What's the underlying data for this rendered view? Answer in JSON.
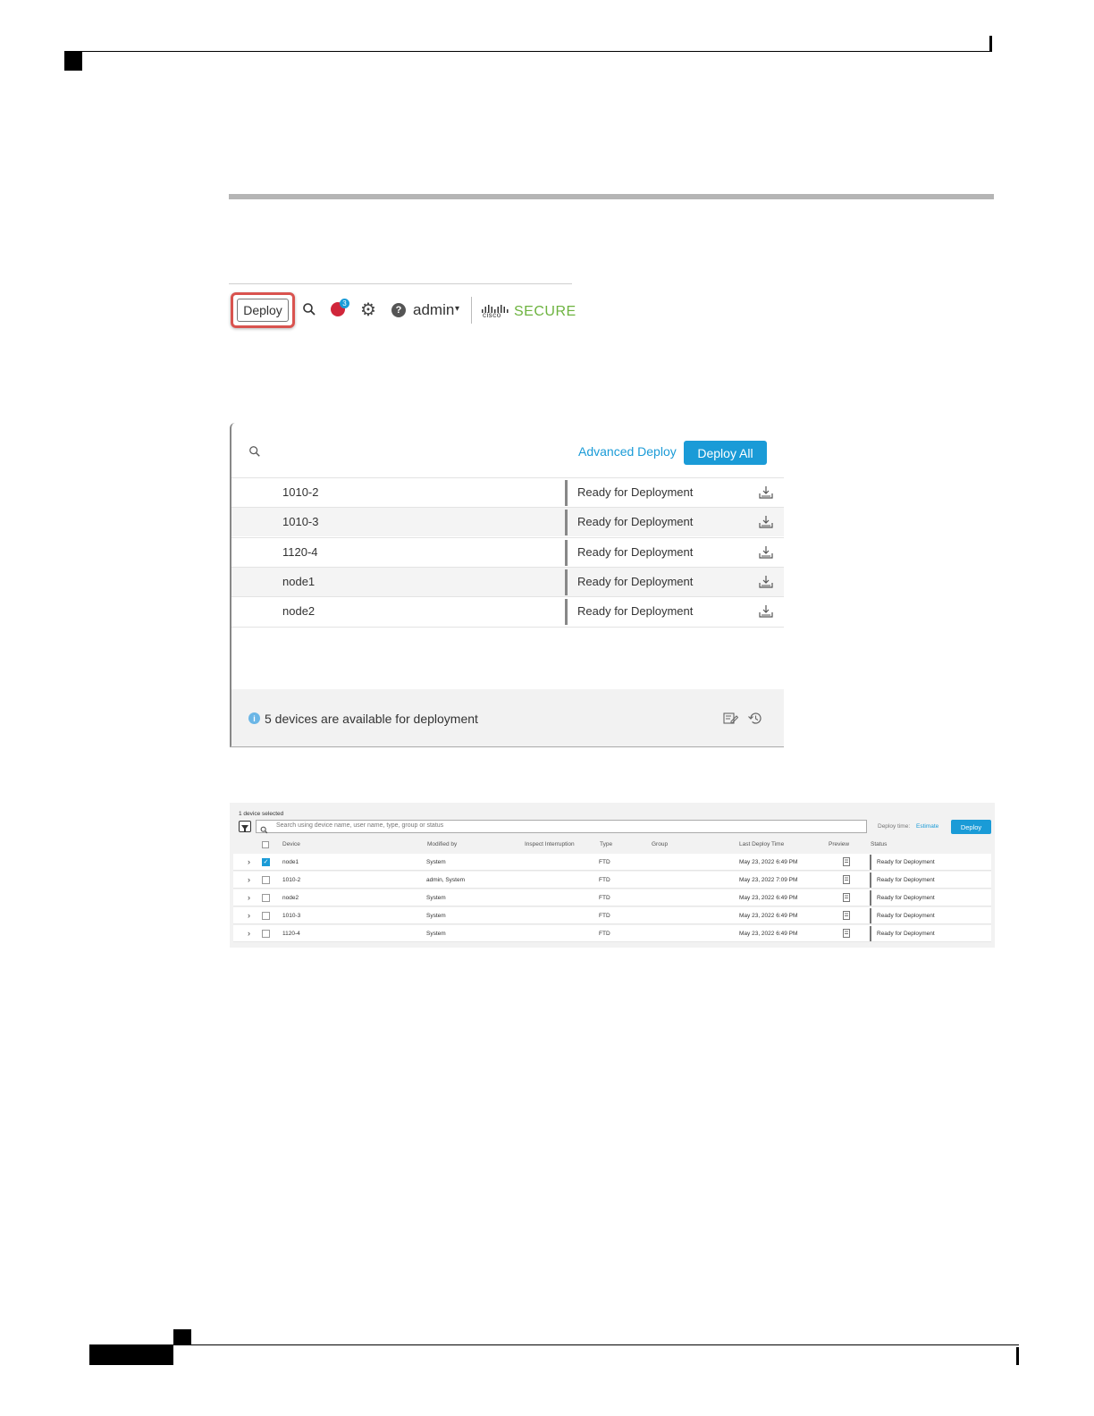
{
  "toolbar": {
    "deploy_label": "Deploy",
    "alert_count": "3",
    "help_glyph": "?",
    "user_label": "admin",
    "caret": "▾",
    "brand_small": "cisco",
    "brand_label": "SECURE"
  },
  "panel": {
    "advanced_label": "Advanced Deploy",
    "deploy_all_label": "Deploy All",
    "rows": [
      {
        "name": "1010-2",
        "status": "Ready for Deployment"
      },
      {
        "name": "1010-3",
        "status": "Ready for Deployment"
      },
      {
        "name": "1120-4",
        "status": "Ready for Deployment"
      },
      {
        "name": "node1",
        "status": "Ready for Deployment"
      },
      {
        "name": "node2",
        "status": "Ready for Deployment"
      }
    ],
    "footer_text": "5 devices are available for deployment",
    "info_glyph": "i"
  },
  "advanced": {
    "selected_text": "1 device selected",
    "search_placeholder": "Search using device name, user name, type, group or status",
    "deploy_time_label": "Deploy time:",
    "estimate_label": "Estimate",
    "deploy_label": "Deploy",
    "headers": {
      "device": "Device",
      "modified_by": "Modified by",
      "inspect": "Inspect Interruption",
      "type": "Type",
      "group": "Group",
      "last_deploy": "Last Deploy Time",
      "preview": "Preview",
      "status": "Status"
    },
    "rows": [
      {
        "device": "node1",
        "modified_by": "System",
        "type": "FTD",
        "last_deploy": "May 23, 2022 6:49 PM",
        "status": "Ready for Deployment",
        "checked": true
      },
      {
        "device": "1010-2",
        "modified_by": "admin, System",
        "type": "FTD",
        "last_deploy": "May 23, 2022 7:09 PM",
        "status": "Ready for Deployment",
        "checked": false
      },
      {
        "device": "node2",
        "modified_by": "System",
        "type": "FTD",
        "last_deploy": "May 23, 2022 6:49 PM",
        "status": "Ready for Deployment",
        "checked": false
      },
      {
        "device": "1010-3",
        "modified_by": "System",
        "type": "FTD",
        "last_deploy": "May 23, 2022 6:49 PM",
        "status": "Ready for Deployment",
        "checked": false
      },
      {
        "device": "1120-4",
        "modified_by": "System",
        "type": "FTD",
        "last_deploy": "May 23, 2022 6:49 PM",
        "status": "Ready for Deployment",
        "checked": false
      }
    ]
  },
  "colors": {
    "accent": "#1a9bd7",
    "highlight": "#d9534f",
    "brand_green": "#6db33f"
  }
}
